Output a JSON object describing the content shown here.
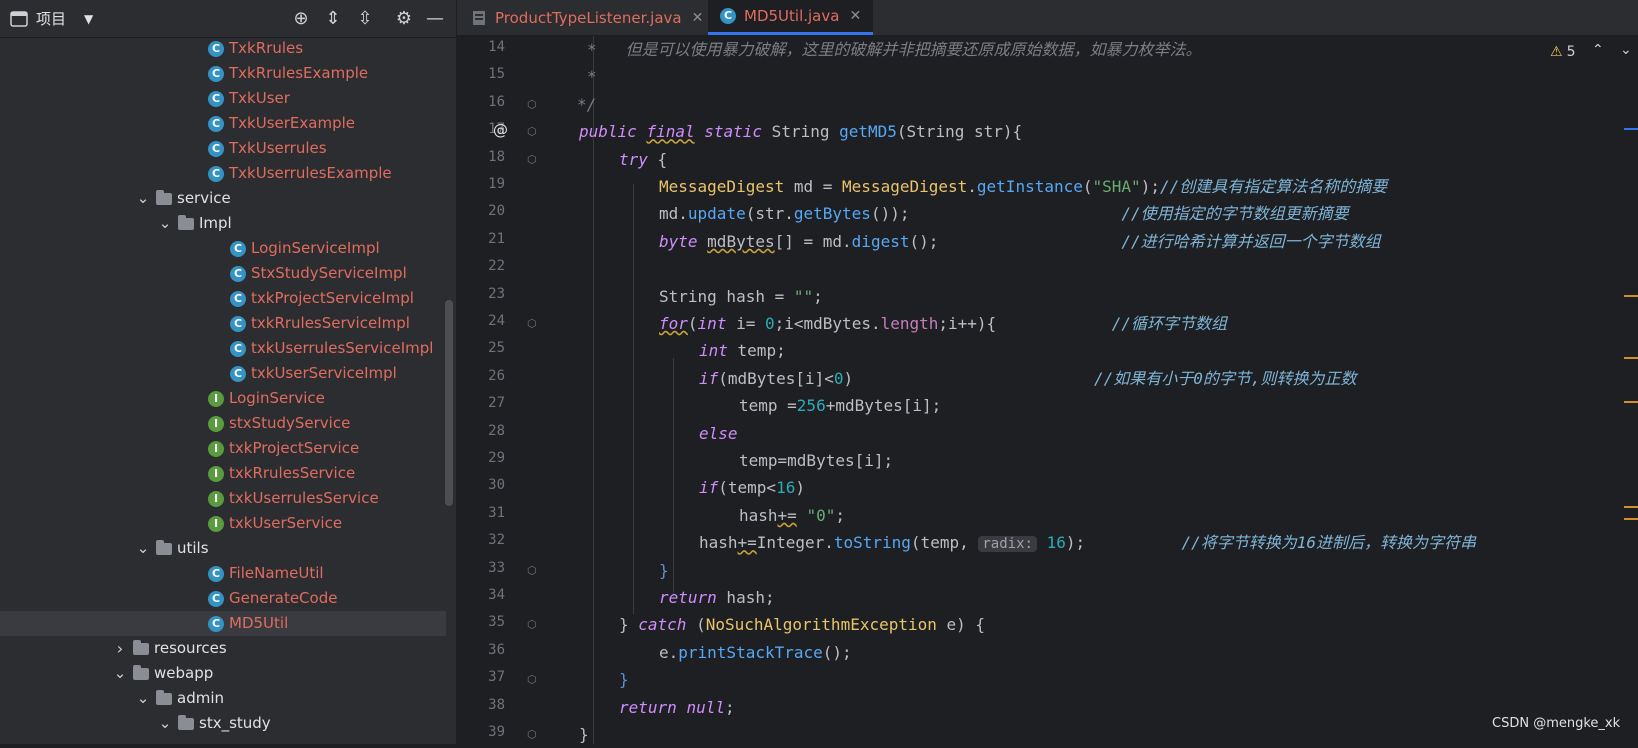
{
  "sidebar": {
    "title": "项目",
    "items": [
      {
        "label": "TxkRrules",
        "icon": "class-icon",
        "depth": 2,
        "color": "red"
      },
      {
        "label": "TxkRrulesExample",
        "icon": "class-icon",
        "depth": 2,
        "color": "red"
      },
      {
        "label": "TxkUser",
        "icon": "class-icon",
        "depth": 2,
        "color": "red"
      },
      {
        "label": "TxkUserExample",
        "icon": "class-icon",
        "depth": 2,
        "color": "red"
      },
      {
        "label": "TxkUserrules",
        "icon": "class-icon",
        "depth": 2,
        "color": "red"
      },
      {
        "label": "TxkUserrulesExample",
        "icon": "class-icon",
        "depth": 2,
        "color": "red"
      },
      {
        "label": "service",
        "icon": "package-folder-icon",
        "depth": 1,
        "color": "white",
        "expanded": true
      },
      {
        "label": "Impl",
        "icon": "package-folder-icon",
        "depth": 2,
        "color": "white",
        "expanded": true
      },
      {
        "label": "LoginServiceImpl",
        "icon": "class-icon",
        "depth": 3,
        "color": "red"
      },
      {
        "label": "StxStudyServiceImpl",
        "icon": "class-icon",
        "depth": 3,
        "color": "red"
      },
      {
        "label": "txkProjectServiceImpl",
        "icon": "class-icon",
        "depth": 3,
        "color": "red"
      },
      {
        "label": "txkRrulesServiceImpl",
        "icon": "class-icon",
        "depth": 3,
        "color": "red"
      },
      {
        "label": "txkUserrulesServiceImpl",
        "icon": "class-icon",
        "depth": 3,
        "color": "red"
      },
      {
        "label": "txkUserServiceImpl",
        "icon": "class-icon",
        "depth": 3,
        "color": "red"
      },
      {
        "label": "LoginService",
        "icon": "interface-icon",
        "depth": 2,
        "color": "red"
      },
      {
        "label": "stxStudyService",
        "icon": "interface-icon",
        "depth": 2,
        "color": "red"
      },
      {
        "label": "txkProjectService",
        "icon": "interface-icon",
        "depth": 2,
        "color": "red"
      },
      {
        "label": "txkRrulesService",
        "icon": "interface-icon",
        "depth": 2,
        "color": "red"
      },
      {
        "label": "txkUserrulesService",
        "icon": "interface-icon",
        "depth": 2,
        "color": "red"
      },
      {
        "label": "txkUserService",
        "icon": "interface-icon",
        "depth": 2,
        "color": "red"
      },
      {
        "label": "utils",
        "icon": "package-folder-icon",
        "depth": 1,
        "color": "white",
        "expanded": true
      },
      {
        "label": "FileNameUtil",
        "icon": "class-icon",
        "depth": 2,
        "color": "red"
      },
      {
        "label": "GenerateCode",
        "icon": "runnable-class-icon",
        "depth": 2,
        "color": "red"
      },
      {
        "label": "MD5Util",
        "icon": "class-icon",
        "depth": 2,
        "color": "red",
        "selected": true
      },
      {
        "label": "resources",
        "icon": "resources-folder-icon",
        "depth": 0,
        "color": "white",
        "expanded": false
      },
      {
        "label": "webapp",
        "icon": "web-folder-icon",
        "depth": 0,
        "color": "white",
        "expanded": true
      },
      {
        "label": "admin",
        "icon": "folder-icon",
        "depth": 1,
        "color": "white",
        "expanded": true
      },
      {
        "label": "stx_study",
        "icon": "folder-icon",
        "depth": 2,
        "color": "white",
        "expanded": true
      }
    ]
  },
  "tabs": [
    {
      "label": "ProductTypeListener.java",
      "icon": "java-file-icon",
      "active": false
    },
    {
      "label": "MD5Util.java",
      "icon": "class-icon",
      "active": true
    }
  ],
  "editor": {
    "warnings_count": "5",
    "line_numbers": [
      "14",
      "15",
      "16",
      "17",
      "18",
      "19",
      "20",
      "21",
      "22",
      "23",
      "24",
      "25",
      "26",
      "27",
      "28",
      "29",
      "30",
      "31",
      "32",
      "33",
      "34",
      "35",
      "36",
      "37",
      "38",
      "39"
    ],
    "annotation_marker": "@",
    "comments": {
      "l14": "*   但是可以使用暴力破解，这里的破解并非把摘要还原成原始数据，如暴力枚举法。",
      "l15": "*",
      "l16": "*/",
      "l19": "//创建具有指定算法名称的摘要",
      "l20": "//使用指定的字节数组更新摘要",
      "l21": "//进行哈希计算并返回一个字节数组",
      "l24": "//循环字节数组",
      "l26": "//如果有小于0的字节,则转换为正数",
      "l32": "//将字节转换为16进制后，转换为字符串"
    },
    "strings": {
      "sha": "\"SHA\"",
      "empty": "\"\"",
      "zero": "\"0\""
    },
    "param_hint": "radix:",
    "accent": "#3574f0"
  },
  "watermark": "CSDN @mengke_xk"
}
